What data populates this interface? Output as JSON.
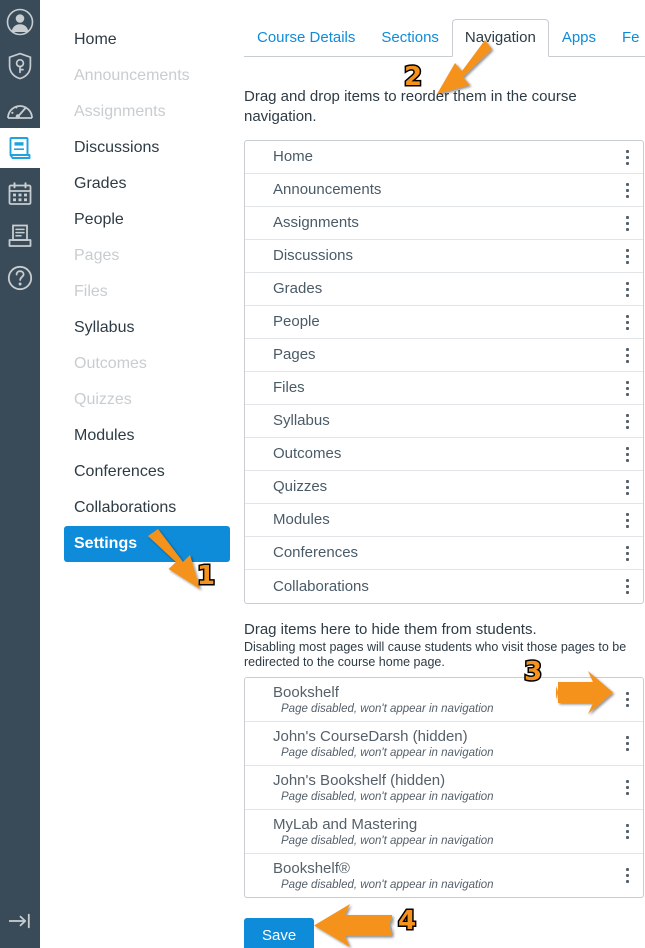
{
  "global_rail": {
    "icons": [
      {
        "name": "account-avatar-icon",
        "label": "Account"
      },
      {
        "name": "admin-shield-key-icon",
        "label": "Admin"
      },
      {
        "name": "dashboard-gauge-icon",
        "label": "Dashboard"
      },
      {
        "name": "courses-book-icon",
        "label": "Courses",
        "active": true
      },
      {
        "name": "calendar-icon",
        "label": "Calendar"
      },
      {
        "name": "inbox-tray-icon",
        "label": "Inbox"
      },
      {
        "name": "help-question-icon",
        "label": "Help"
      }
    ],
    "collapse": {
      "name": "collapse-arrow-icon",
      "label": "Minimize Global Navigation"
    }
  },
  "course_nav": {
    "items": [
      {
        "label": "Home",
        "state": "enabled"
      },
      {
        "label": "Announcements",
        "state": "muted"
      },
      {
        "label": "Assignments",
        "state": "muted"
      },
      {
        "label": "Discussions",
        "state": "enabled"
      },
      {
        "label": "Grades",
        "state": "enabled"
      },
      {
        "label": "People",
        "state": "enabled"
      },
      {
        "label": "Pages",
        "state": "muted"
      },
      {
        "label": "Files",
        "state": "muted"
      },
      {
        "label": "Syllabus",
        "state": "enabled"
      },
      {
        "label": "Outcomes",
        "state": "muted"
      },
      {
        "label": "Quizzes",
        "state": "muted"
      },
      {
        "label": "Modules",
        "state": "enabled"
      },
      {
        "label": "Conferences",
        "state": "enabled"
      },
      {
        "label": "Collaborations",
        "state": "enabled"
      },
      {
        "label": "Settings",
        "state": "active"
      }
    ]
  },
  "tabs": [
    {
      "label": "Course Details",
      "active": false
    },
    {
      "label": "Sections",
      "active": false
    },
    {
      "label": "Navigation",
      "active": true
    },
    {
      "label": "Apps",
      "active": false
    },
    {
      "label": "Fe",
      "active": false
    }
  ],
  "main": {
    "reorder_instruction": "Drag and drop items to reorder them in the course navigation.",
    "hide_title": "Drag items here to hide them from students.",
    "hide_subtitle": "Disabling most pages will cause students who visit those pages to be redirected to the course home page.",
    "save_label": "Save"
  },
  "nav_list": {
    "kebab_label": "Options",
    "items": [
      {
        "label": "Home"
      },
      {
        "label": "Announcements"
      },
      {
        "label": "Assignments"
      },
      {
        "label": "Discussions"
      },
      {
        "label": "Grades"
      },
      {
        "label": "People"
      },
      {
        "label": "Pages"
      },
      {
        "label": "Files"
      },
      {
        "label": "Syllabus"
      },
      {
        "label": "Outcomes"
      },
      {
        "label": "Quizzes"
      },
      {
        "label": "Modules"
      },
      {
        "label": "Conferences"
      },
      {
        "label": "Collaborations"
      }
    ]
  },
  "hidden_list": {
    "items": [
      {
        "label": "Bookshelf",
        "status": "Page disabled, won't appear in navigation"
      },
      {
        "label": "John's CourseDarsh (hidden)",
        "status": "Page disabled, won't appear in navigation"
      },
      {
        "label": "John's Bookshelf (hidden)",
        "status": "Page disabled, won't appear in navigation"
      },
      {
        "label": "MyLab and Mastering",
        "status": "Page disabled, won't appear in navigation"
      },
      {
        "label": "Bookshelf®",
        "status": "Page disabled, won't appear in navigation"
      }
    ]
  },
  "annotations": {
    "markers": [
      {
        "number": "1",
        "target": "settings-sidebar-item"
      },
      {
        "number": "2",
        "target": "navigation-tab"
      },
      {
        "number": "3",
        "target": "hidden-item-kebab"
      },
      {
        "number": "4",
        "target": "save-button"
      }
    ],
    "color": "#F5921E"
  },
  "colors": {
    "rail_bg": "#394B58",
    "accent_blue": "#0e8cd9",
    "text_dark": "#2D3B45",
    "text_muted": "#C7CDD1",
    "border": "#C7CDD1",
    "annotation_orange": "#F5921E"
  }
}
